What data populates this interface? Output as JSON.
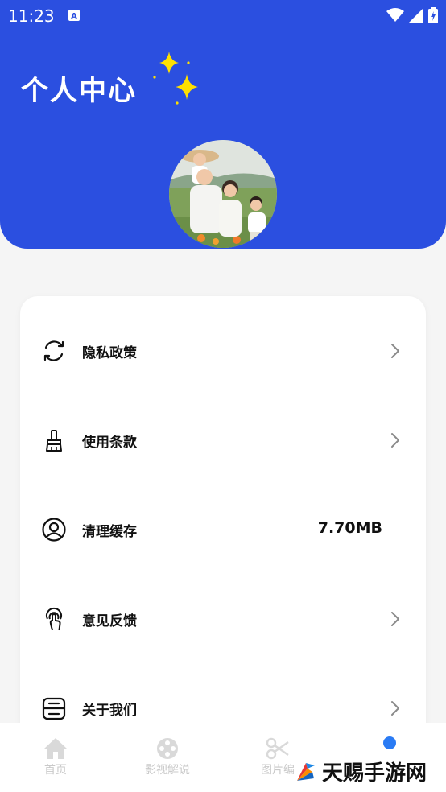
{
  "status_bar": {
    "time": "11:23"
  },
  "header": {
    "title": "个人中心"
  },
  "menu": {
    "items": [
      {
        "label": "隐私政策",
        "icon": "refresh-circle-icon"
      },
      {
        "label": "使用条款",
        "icon": "brush-icon"
      },
      {
        "label": "清理缓存",
        "icon": "user-circle-icon",
        "value": "7.70MB"
      },
      {
        "label": "意见反馈",
        "icon": "touch-icon"
      },
      {
        "label": "关于我们",
        "icon": "info-box-icon"
      }
    ]
  },
  "bottom_nav": {
    "items": [
      {
        "label": "首页",
        "icon": "home-icon"
      },
      {
        "label": "影视解说",
        "icon": "film-reel-icon"
      },
      {
        "label": "图片编",
        "icon": "scissors-icon"
      },
      {
        "label": "",
        "icon": "dot-indicator"
      }
    ]
  },
  "watermark": {
    "text": "天赐手游网"
  },
  "colors": {
    "header_bg": "#2b4fe0",
    "accent": "#2a7bf4",
    "sparkle": "#ffe000"
  }
}
